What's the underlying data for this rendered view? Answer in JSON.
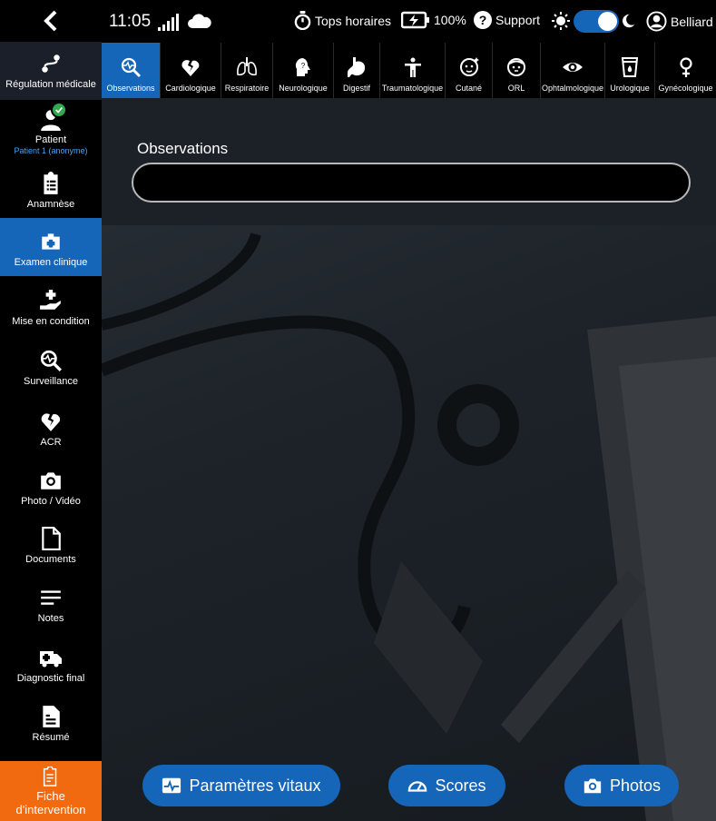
{
  "topbar": {
    "time": "11:05",
    "tops_label": "Tops horaires",
    "battery": "100%",
    "support_label": "Support",
    "user_name": "Belliard"
  },
  "sidebar": {
    "items": [
      {
        "label": "Régulation médicale",
        "icon": "route-icon"
      },
      {
        "label": "Patient",
        "sub": "Patient 1 (anonyme)",
        "icon": "patient-icon"
      },
      {
        "label": "Anamnèse",
        "icon": "clipboard-icon"
      },
      {
        "label": "Examen clinique",
        "icon": "medical-kit-icon"
      },
      {
        "label": "Mise en condition",
        "icon": "hand-care-icon"
      },
      {
        "label": "Surveillance",
        "icon": "monitor-search-icon"
      },
      {
        "label": "ACR",
        "icon": "broken-heart-icon"
      },
      {
        "label": "Photo / Vidéo",
        "icon": "camera-icon"
      },
      {
        "label": "Documents",
        "icon": "document-icon"
      },
      {
        "label": "Notes",
        "icon": "notes-icon"
      },
      {
        "label": "Diagnostic final",
        "icon": "ambulance-icon"
      },
      {
        "label": "Résumé",
        "icon": "summary-icon"
      }
    ],
    "fiche_label_1": "Fiche",
    "fiche_label_2": "d'intervention"
  },
  "tabs": [
    {
      "label": "Observations",
      "icon": "observation-icon"
    },
    {
      "label": "Cardiologique",
      "icon": "broken-heart-icon"
    },
    {
      "label": "Respiratoire",
      "icon": "lungs-icon"
    },
    {
      "label": "Neurologique",
      "icon": "head-icon"
    },
    {
      "label": "Digestif",
      "icon": "stomach-icon"
    },
    {
      "label": "Traumatologique",
      "icon": "person-icon"
    },
    {
      "label": "Cutané",
      "icon": "face-icon"
    },
    {
      "label": "ORL",
      "icon": "face-ear-icon"
    },
    {
      "label": "Ophtalmologique",
      "icon": "eye-icon"
    },
    {
      "label": "Urologique",
      "icon": "cup-icon"
    },
    {
      "label": "Gynécologique",
      "icon": "female-icon"
    }
  ],
  "main": {
    "observations_label": "Observations",
    "observations_value": ""
  },
  "buttons": {
    "vitals": "Paramètres vitaux",
    "scores": "Scores",
    "photos": "Photos"
  },
  "colors": {
    "accent": "#1565b8",
    "fiche": "#f26a10",
    "badge": "#2fa84f"
  }
}
